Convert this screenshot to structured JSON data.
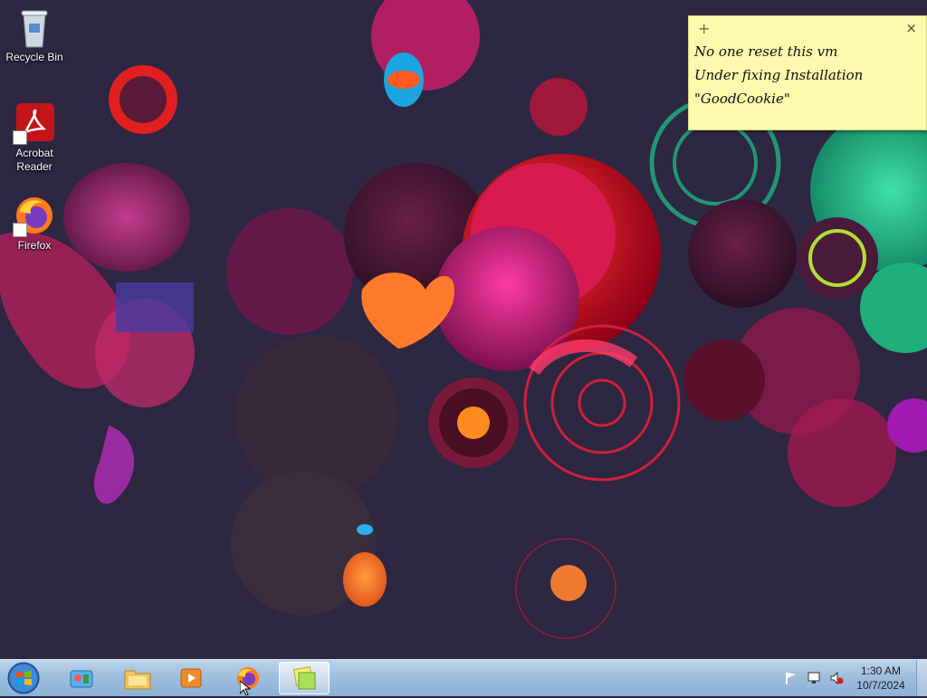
{
  "desktop_icons": [
    {
      "label": "Recycle Bin",
      "icon": "recycle-bin-icon"
    },
    {
      "label": "Acrobat\nReader",
      "icon": "acrobat-reader-icon"
    },
    {
      "label": "Firefox",
      "icon": "firefox-icon"
    }
  ],
  "sticky_note": {
    "lines": [
      "No one reset this vm",
      "Under fixing Installation",
      "\"GoodCookie\""
    ],
    "add_symbol": "+",
    "close_symbol": "×",
    "color": "#fcf8ad"
  },
  "taskbar": {
    "start_icon": "windows-start-orb-icon",
    "pinned": [
      {
        "icon": "control-panel-icon"
      },
      {
        "icon": "file-explorer-icon"
      },
      {
        "icon": "media-player-icon"
      },
      {
        "icon": "firefox-icon"
      },
      {
        "icon": "sticky-notes-icon",
        "active": true
      }
    ],
    "tray_icons": [
      "action-center-flag-icon",
      "network-icon",
      "volume-muted-icon"
    ],
    "clock": {
      "time": "1:30 AM",
      "date": "10/7/2024"
    }
  },
  "colors": {
    "taskbar": "#9fbedd",
    "wallpaper_base": "#2b2540"
  }
}
